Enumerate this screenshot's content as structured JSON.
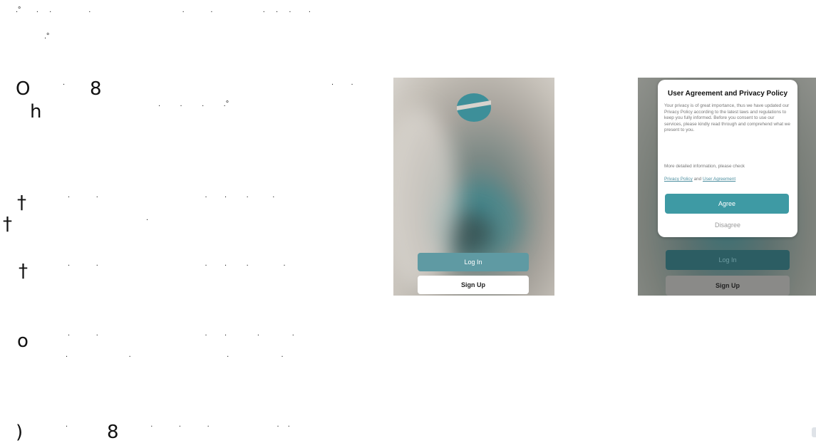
{
  "left_fragments": {
    "row1_a": "O",
    "row1_b": "8",
    "row1_c": "h",
    "row2_a": "†",
    "row2_b": "†",
    "row3_a": "†",
    "row4_a": "o",
    "row5_a": ")",
    "row5_b": "8"
  },
  "phone1": {
    "login_label": "Log In",
    "signup_label": "Sign Up",
    "accent": "#5f9aa3"
  },
  "phone2": {
    "dialog": {
      "title": "User Agreement and Privacy Policy",
      "body": "Your privacy is of great importance, thus we have updated our Privacy Policy according to the latest laws and regulations to keep you fully informed. Before you consent to use our services, please kindly read through and comprehend what we present to you.",
      "more_info": "More detailed information, please check",
      "privacy_link": "Privacy Policy",
      "and_text": "and",
      "agreement_link": "User Agreement",
      "agree_label": "Agree",
      "disagree_label": "Disagree"
    },
    "login_label": "Log In",
    "signup_label": "Sign Up",
    "accent": "#3e9aa4"
  }
}
